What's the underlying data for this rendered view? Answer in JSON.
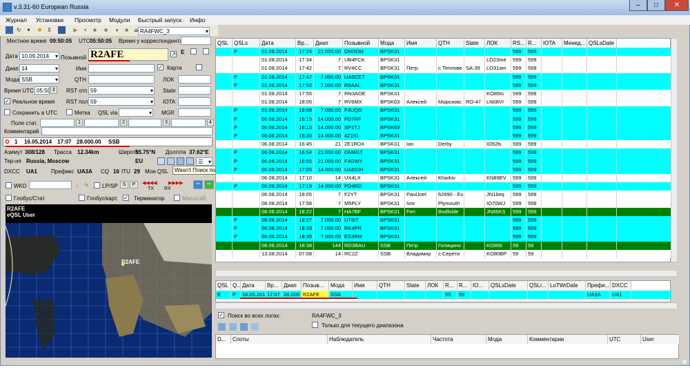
{
  "title": "v.3.31-60 European Russia",
  "menu": [
    "Журнал",
    "Установки",
    "Просмотр",
    "Модули",
    "Быстрый запуск",
    "Инфо"
  ],
  "station": "RA4FWC_3",
  "times": {
    "local_label": "Местное время",
    "local": "09:50:05",
    "utc_label": "UTC",
    "utc": "05:50:05",
    "corr_label": "Время у корреспондента"
  },
  "form": {
    "date_label": "Дата",
    "date": "10.09.2014",
    "call_label": "Позывной",
    "call": "R2AFE",
    "band_label": "Диап",
    "band": "14",
    "name_label": "Имя",
    "mode_label": "Мода",
    "mode": "SSB",
    "qth_label": "QTH",
    "time_label": "Время UTC",
    "time": "05:50",
    "rst_s_label": "RST отп",
    "rst_s": "59",
    "rst_r_label": "RST пол",
    "rst_r": "59",
    "realtime": "Реальное время",
    "save_utc": "Сохранить в UTC",
    "mark": "Метка",
    "qsl_via": "QSL via",
    "stat_field": "Поле стат.",
    "comment_label": "Комментарий",
    "card": "Карта",
    "loc_label": "ЛОК",
    "state_label": "State",
    "iota_label": "IOTA",
    "mgr_label": "MGR",
    "e_label": "E",
    "t1": "1",
    "t2": "2",
    "t3": "3",
    "t4": "4"
  },
  "info": {
    "n": "1",
    "date": "16.05.2014",
    "time": "17:07",
    "freq": "28.000.00",
    "mode": "SSB",
    "azimuth_label": "Азимут",
    "azimuth": "308/128",
    "route_label": "Трасса",
    "route": "12.34km",
    "lat_label": "Широта",
    "lat": "55.75°N",
    "lon_label": "Долгота",
    "lon": "37.62°E",
    "terr_label": "Тер-ия",
    "terr": "Russia, Moscow",
    "cont": "EU",
    "dxcc_label": "DXCC",
    "dxcc": "UA1",
    "prefix_label": "Префикс",
    "prefix": "UA3A",
    "cq_label": "CQ",
    "cq": "16",
    "itu_label": "ITU",
    "itu": "29",
    "myqsl": "Мои QSL",
    "tooltip_a": "Wasn't",
    "tooltip": "Поиск позывного в Интернет"
  },
  "controls": {
    "wkd": "WKD",
    "lpsp": "LP/SP",
    "s": "S",
    "p": "P",
    "tx": "TX",
    "rx": "RX",
    "globus_stat": "Глобус/Стат.",
    "globus_map": "Глобус/карт.",
    "terminator": "Терминатор",
    "scale": "Масштаб"
  },
  "mapinfo": {
    "call": "R2AFE",
    "user": "eQSL User",
    "marker": "R2AFE"
  },
  "colors": {
    "cyan": "#00ffff",
    "green": "#008000",
    "white": "#ffffff"
  },
  "log_headers": [
    "QSL",
    "QSLs",
    "Дата",
    "Вр...",
    "Диап",
    "Позывной",
    "Мода",
    "Имя",
    "QTH",
    "State",
    "ЛОК",
    "RS...",
    "R...",
    "IOTA",
    "Менед...",
    "QSLsDate"
  ],
  "log_rows": [
    {
      "c": "cyan",
      "v": [
        "",
        "P",
        "01.08.2014",
        "17:24",
        "21.000.00",
        "OM3DM",
        "BPSK31",
        "",
        "",
        "",
        "",
        "599",
        "599",
        "",
        "",
        ""
      ]
    },
    {
      "c": "white",
      "v": [
        "",
        "",
        "01.08.2014",
        "17:34",
        "7",
        "UB4FCK",
        "BPSK31",
        "",
        "",
        "",
        "LO23me",
        "599",
        "599",
        "",
        "",
        ""
      ]
    },
    {
      "c": "white",
      "v": [
        "",
        "",
        "01.08.2014",
        "17:42",
        "7",
        "RV4CC",
        "BPSK31",
        "Петр",
        "с.Теплове",
        "SA-39",
        "LO31am",
        "599",
        "599",
        "",
        "",
        ""
      ]
    },
    {
      "c": "cyan",
      "v": [
        "",
        "P",
        "01.08.2014",
        "17:47",
        "7.000.00",
        "UA6CET",
        "BPSK31",
        "",
        "",
        "",
        "",
        "599",
        "599",
        "",
        "",
        ""
      ]
    },
    {
      "c": "cyan",
      "v": [
        "",
        "P",
        "01.08.2014",
        "17:52",
        "7.000.00",
        "R9AAL",
        "BPSK31",
        "",
        "",
        "",
        "",
        "599",
        "599",
        "",
        "",
        ""
      ]
    },
    {
      "c": "white",
      "v": [
        "",
        "",
        "01.08.2014",
        "17:55",
        "7",
        "RN3AOE",
        "BPSK31",
        "",
        "",
        "",
        "KO85ts",
        "599",
        "599",
        "",
        "",
        ""
      ]
    },
    {
      "c": "white",
      "v": [
        "",
        "",
        "01.08.2014",
        "18:05",
        "7",
        "RV6MX",
        "BPSK63",
        "Алексей",
        "Морозовс",
        "RO-47",
        "LN08VI",
        "599",
        "599",
        "",
        "",
        ""
      ]
    },
    {
      "c": "cyan",
      "v": [
        "",
        "P",
        "01.08.2014",
        "18:08",
        "7.000.00",
        "F4UQD",
        "BPSK31",
        "",
        "",
        "",
        "",
        "599",
        "599",
        "",
        "",
        ""
      ]
    },
    {
      "c": "cyan",
      "v": [
        "",
        "P",
        "06.08.2014",
        "16:15",
        "14.000.00",
        "PD7RF",
        "BPSK31",
        "",
        "",
        "",
        "",
        "599",
        "599",
        "",
        "",
        ""
      ]
    },
    {
      "c": "cyan",
      "v": [
        "",
        "P",
        "06.08.2014",
        "16:15",
        "14.000.00",
        "SP1TJ",
        "BPSK63",
        "",
        "",
        "",
        "",
        "599",
        "599",
        "",
        "",
        ""
      ]
    },
    {
      "c": "cyan",
      "v": [
        "",
        "P",
        "06.08.2014",
        "16:30",
        "14.000.00",
        "4Z1IG",
        "BPSK31",
        "",
        "",
        "",
        "",
        "599",
        "599",
        "",
        "",
        ""
      ]
    },
    {
      "c": "white",
      "v": [
        "",
        "",
        "06.08.2014",
        "16:45",
        "21",
        "2E1RDX",
        "BPSK31",
        "Ian",
        "Derby",
        "",
        "IO92ls",
        "599",
        "599",
        "",
        "",
        ""
      ]
    },
    {
      "c": "cyan",
      "v": [
        "",
        "P",
        "06.08.2014",
        "16:54",
        "21.000.00",
        "OM8GT",
        "BPSK31",
        "",
        "",
        "",
        "",
        "599",
        "599",
        "",
        "",
        ""
      ]
    },
    {
      "c": "cyan",
      "v": [
        "",
        "P",
        "06.08.2014",
        "16:55",
        "21.000.00",
        "F4GWY",
        "BPSK31",
        "",
        "",
        "",
        "",
        "599",
        "599",
        "",
        "",
        ""
      ]
    },
    {
      "c": "cyan",
      "v": [
        "",
        "P",
        "06.08.2014",
        "17:05",
        "14.000.00",
        "UA6CIH",
        "BPSK31",
        "",
        "",
        "",
        "",
        "599",
        "599",
        "",
        "",
        ""
      ]
    },
    {
      "c": "white",
      "v": [
        "",
        "",
        "06.08.2014",
        "17:10",
        "14",
        "UX4LX",
        "BPSK31",
        "Алексей",
        "Kharkiv",
        "",
        "KN89EV",
        "599",
        "599",
        "",
        "",
        ""
      ]
    },
    {
      "c": "cyan",
      "v": [
        "",
        "P",
        "06.08.2014",
        "17:19",
        "14.000.00",
        "PD4RD",
        "BPSK31",
        "",
        "",
        "",
        "",
        "599",
        "599",
        "",
        "",
        ""
      ]
    },
    {
      "c": "white",
      "v": [
        "",
        "",
        "06.08.2014",
        "18:05",
        "7",
        "F2YT",
        "BPSK31",
        "PaulJoel",
        "62690 - Es",
        "",
        "JN16eq",
        "599",
        "599",
        "",
        "",
        ""
      ]
    },
    {
      "c": "white",
      "v": [
        "",
        "",
        "08.08.2014",
        "17:58",
        "7",
        "M5PLY",
        "BPSK31",
        "Ivor",
        "Plymouth",
        "",
        "IO70WJ",
        "599",
        "599",
        "",
        "",
        ""
      ]
    },
    {
      "c": "green",
      "v": [
        "",
        "",
        "08.08.2014",
        "18:22",
        "7",
        "HA7BF",
        "BPSK31",
        "Feri",
        "Bodfolde",
        "",
        "JN86KS",
        "599",
        "599",
        "",
        "",
        ""
      ]
    },
    {
      "c": "cyan",
      "v": [
        "",
        "P",
        "08.08.2014",
        "18:27",
        "7.000.00",
        "UT8IT",
        "BPSK31",
        "",
        "",
        "",
        "",
        "599",
        "599",
        "",
        "",
        ""
      ]
    },
    {
      "c": "cyan",
      "v": [
        "",
        "P",
        "08.08.2014",
        "18:33",
        "7.000.00",
        "RK4PR",
        "BPSK31",
        "",
        "",
        "",
        "",
        "599",
        "599",
        "",
        "",
        ""
      ]
    },
    {
      "c": "cyan",
      "v": [
        "",
        "P",
        "08.08.2014",
        "18:35",
        "7.000.00",
        "ES3RM",
        "BPSK31",
        "",
        "",
        "",
        "",
        "599",
        "599",
        "",
        "",
        ""
      ]
    },
    {
      "c": "green",
      "v": [
        "",
        "",
        "08.08.2014",
        "18:38",
        "144",
        "RD3BAU",
        "SSB",
        "Петр",
        "Голицино",
        "",
        "KO85ti",
        "59",
        "59",
        "",
        "",
        ""
      ]
    },
    {
      "c": "white",
      "v": [
        "",
        "",
        "13.08.2014",
        "07:08",
        "14",
        "RC2Z",
        "SSB",
        "Владимир",
        "с.Серети",
        "",
        "KO80BP",
        "59",
        "59",
        "",
        "",
        ""
      ]
    }
  ],
  "lower_headers": [
    "QSL",
    "Q...",
    "Дата",
    "Вр...",
    "Диап",
    "Позыв...",
    "Мода",
    "Имя",
    "QTH",
    "State",
    "ЛОК",
    "R...",
    "R...",
    "IO...",
    "QSLsDate",
    "QSLr...",
    "LoTWrDate",
    "Префи...",
    "DXCC"
  ],
  "lower_row": [
    "E",
    "P",
    "16.05.201",
    "17:07",
    "28.000",
    "R2AFE",
    "SSB",
    "",
    "",
    "",
    "",
    "59",
    "59",
    "",
    "",
    "",
    "",
    "UA3A",
    "UA1"
  ],
  "search": {
    "all_logs": "Поиск во всех логах:",
    "log": "RA4FWC_3",
    "band_only": "Только для текущего диапазона"
  },
  "spots_headers": [
    "D...",
    "Споты",
    "Наблюдатель",
    "Частота",
    "Мода",
    "Комментарии",
    "UTC",
    "User"
  ]
}
